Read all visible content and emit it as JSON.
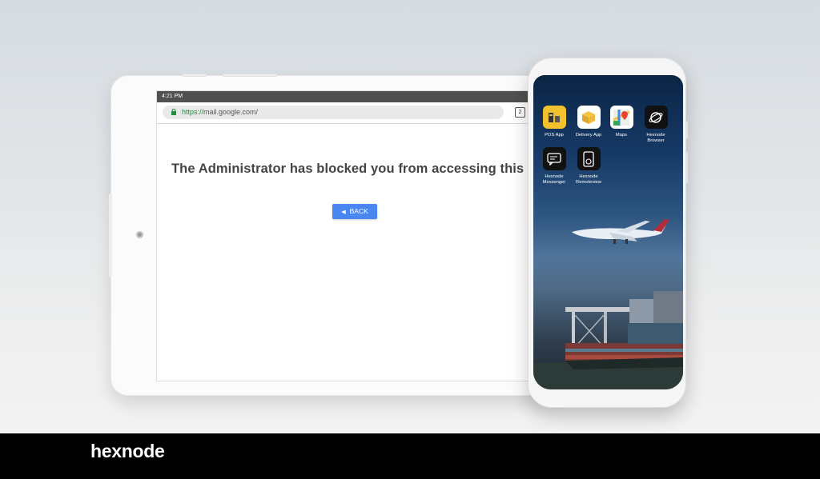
{
  "tablet": {
    "status_time": "4:21 PM",
    "url_scheme": "https://",
    "url_rest": "mail.google.com/",
    "tab_count": "2",
    "blocked_message": "The Administrator has blocked you from accessing this page",
    "back_label": "BACK"
  },
  "phone": {
    "apps": [
      {
        "label": "POS App",
        "icon": "pos-app-icon",
        "color": "#f2c12e"
      },
      {
        "label": "Delivery App",
        "icon": "delivery-box-icon",
        "color": "#ffffff"
      },
      {
        "label": "Maps",
        "icon": "maps-icon",
        "color": "#ffffff"
      },
      {
        "label": "Hexnode Browser",
        "icon": "browser-globe-icon",
        "color": "#111111"
      },
      {
        "label": "Hexnode Messenger",
        "icon": "messenger-icon",
        "color": "#111111"
      },
      {
        "label": "Hexnode Remoteview",
        "icon": "remoteview-icon",
        "color": "#111111"
      }
    ]
  },
  "footer": {
    "brand": "hexnode"
  }
}
